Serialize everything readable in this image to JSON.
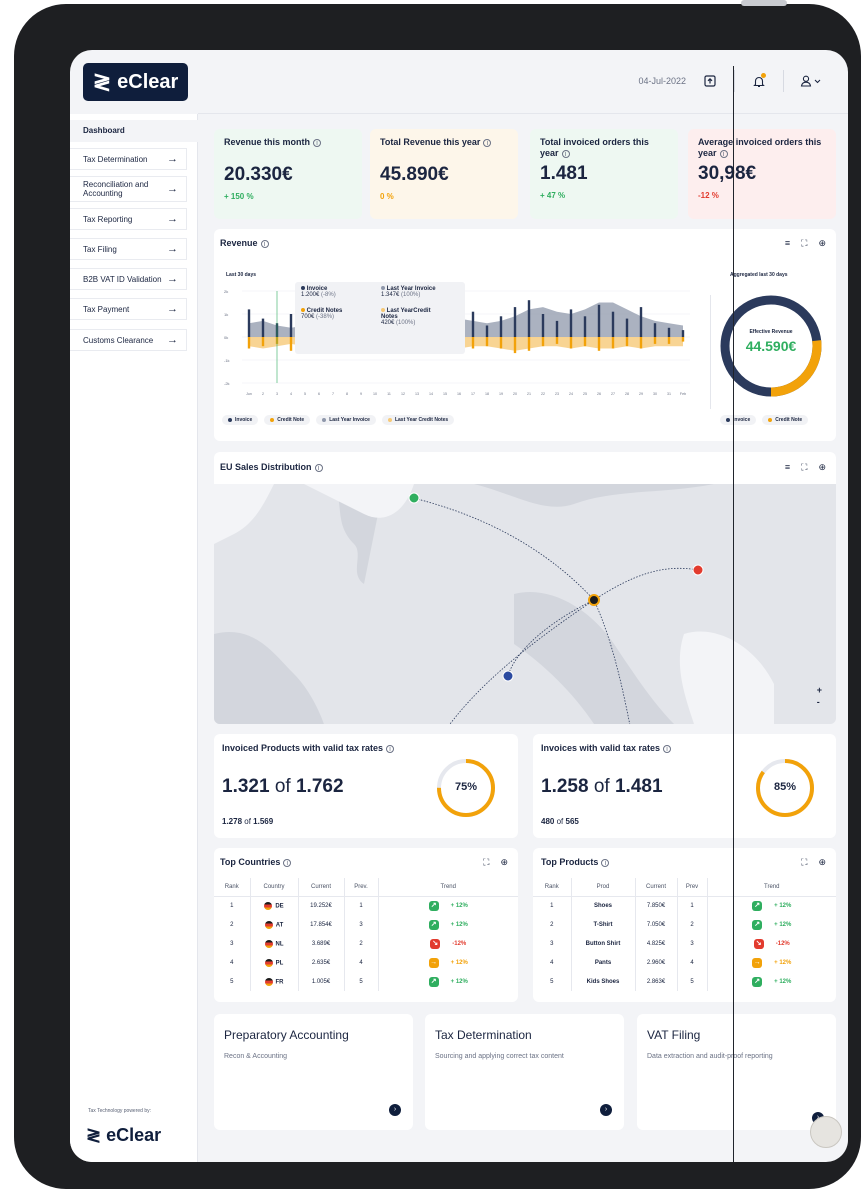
{
  "topbar": {
    "date": "04-Jul-2022"
  },
  "brand": {
    "logo_text": "eClear",
    "logo_mark": "≷",
    "powered_by": "Tax Technology powered by:",
    "bottom_logo_text": "eClear"
  },
  "sidebar": {
    "active": "Dashboard",
    "items": [
      {
        "label": "Tax Determination"
      },
      {
        "label": "Reconciliation and Accounting"
      },
      {
        "label": "Tax Reporting"
      },
      {
        "label": "Tax Filing"
      },
      {
        "label": "B2B VAT ID Validation"
      },
      {
        "label": "Tax Payment"
      },
      {
        "label": "Customs Clearance"
      }
    ]
  },
  "kpis": [
    {
      "title": "Revenue this month",
      "value": "20.330€",
      "change": "+ 150 %",
      "color": "#2fae5f",
      "bg": "#eef8f2"
    },
    {
      "title": "Total Revenue this year",
      "value": "45.890€",
      "change": "0 %",
      "color": "#f2a20a",
      "bg": "#fdf6ea"
    },
    {
      "title": "Total invoiced orders this year",
      "value": "1.481",
      "change": "+ 47 %",
      "color": "#2fae5f",
      "bg": "#eef8f2"
    },
    {
      "title": "Average invoiced orders this year",
      "value": "30,98€",
      "change": "-12 %",
      "color": "#e23b2e",
      "bg": "#fdeeee"
    }
  ],
  "revenue": {
    "title": "Revenue",
    "left_sub": "Last 30 days",
    "right_sub": "Aggregated last 30 days",
    "tooltip": {
      "invoice_label": "Invoice",
      "invoice_value": "1.200€",
      "invoice_pct": "(-8%)",
      "ly_invoice_label": "Last Year Invoice",
      "ly_invoice_value": "1.347€",
      "ly_invoice_pct": "(100%)",
      "credit_label": "Credit Notes",
      "credit_value": "700€",
      "credit_pct": "(-38%)",
      "ly_credit_label": "Last YearCredit Notes",
      "ly_credit_value": "420€",
      "ly_credit_pct": "(100%)"
    },
    "legend": [
      "Invoice",
      "Credit Note",
      "Last Year Invoice",
      "Last Year Credit Notes"
    ],
    "donut_legend": [
      "Invoice",
      "Credit Note"
    ],
    "donut_title": "Effective Revenue",
    "donut_value": "44.590€",
    "donut_invoice_share": 0.73,
    "colors": {
      "invoice": "#2b3a5c",
      "credit": "#f2a20a",
      "ly_invoice": "#8f98ab",
      "ly_credit": "#f6c978",
      "donut_teal": "#2fae5f"
    }
  },
  "chart_data": {
    "type": "bar",
    "y_ticks": [
      "2k",
      "1k",
      "0k",
      "-1k",
      "-2k"
    ],
    "ylim": [
      -2000,
      2000
    ],
    "categories": [
      "Jun",
      "2",
      "3",
      "4",
      "5",
      "6",
      "7",
      "8",
      "9",
      "10",
      "11",
      "12",
      "13",
      "14",
      "15",
      "16",
      "17",
      "18",
      "19",
      "20",
      "21",
      "22",
      "23",
      "24",
      "25",
      "26",
      "27",
      "28",
      "29",
      "30",
      "31",
      "Feb"
    ],
    "series": [
      {
        "name": "Invoice",
        "values": [
          1200,
          800,
          600,
          1000,
          400,
          900,
          1100,
          700,
          500,
          1300,
          900,
          600,
          1200,
          800,
          1400,
          700,
          1100,
          500,
          900,
          1300,
          1600,
          1000,
          700,
          1200,
          900,
          1400,
          1100,
          800,
          1300,
          600,
          400,
          300
        ]
      },
      {
        "name": "Credit Note",
        "values": [
          -500,
          -400,
          -300,
          -600,
          -300,
          -500,
          -700,
          -300,
          -400,
          -600,
          -500,
          -300,
          -500,
          -400,
          -600,
          -300,
          -500,
          -400,
          -500,
          -700,
          -600,
          -400,
          -300,
          -500,
          -400,
          -600,
          -500,
          -400,
          -500,
          -300,
          -300,
          -200
        ]
      },
      {
        "name": "Last Year Invoice",
        "values": [
          600,
          700,
          500,
          400,
          500,
          500,
          600,
          700,
          800,
          900,
          900,
          700,
          600,
          800,
          900,
          800,
          700,
          600,
          700,
          900,
          1200,
          1300,
          1100,
          1000,
          1200,
          1500,
          1500,
          1200,
          900,
          700,
          600,
          500
        ]
      },
      {
        "name": "Last Year Credit Notes",
        "values": [
          -400,
          -500,
          -400,
          -300,
          -400,
          -500,
          -600,
          -500,
          -400,
          -500,
          -600,
          -500,
          -400,
          -500,
          -600,
          -500,
          -400,
          -400,
          -500,
          -600,
          -500,
          -400,
          -400,
          -500,
          -400,
          -500,
          -500,
          -400,
          -500,
          -400,
          -400,
          -400
        ]
      }
    ]
  },
  "map": {
    "title": "EU Sales Distribution",
    "zoom_in": "+",
    "zoom_out": "-"
  },
  "valid_products": {
    "title": "Invoiced Products with valid tax rates",
    "count": "1.321",
    "of": "of",
    "total": "1.762",
    "sub_count": "1.278",
    "sub_total": "1.569",
    "pct": "75%",
    "pct_value": 0.75
  },
  "valid_invoices": {
    "title": "Invoices with valid tax rates",
    "count": "1.258",
    "of": "of",
    "total": "1.481",
    "sub_count": "480",
    "sub_total": "565",
    "pct": "85%",
    "pct_value": 0.85
  },
  "top_countries": {
    "title": "Top Countries",
    "headers": [
      "Rank",
      "Country",
      "Current",
      "Prev.",
      "Trend"
    ],
    "rows": [
      {
        "rank": "1",
        "country": "DE",
        "current": "19.252€",
        "prev": "1",
        "trend": "+ 12%",
        "trend_color": "#2fae5f",
        "arrow": "↗"
      },
      {
        "rank": "2",
        "country": "AT",
        "current": "17.854€",
        "prev": "3",
        "trend": "+ 12%",
        "trend_color": "#2fae5f",
        "arrow": "↗"
      },
      {
        "rank": "3",
        "country": "NL",
        "current": "3.689€",
        "prev": "2",
        "trend": "-12%",
        "trend_color": "#e23b2e",
        "arrow": "↘"
      },
      {
        "rank": "4",
        "country": "PL",
        "current": "2.635€",
        "prev": "4",
        "trend": "+ 12%",
        "trend_color": "#f2a20a",
        "arrow": "→"
      },
      {
        "rank": "5",
        "country": "FR",
        "current": "1.005€",
        "prev": "5",
        "trend": "+ 12%",
        "trend_color": "#2fae5f",
        "arrow": "↗"
      }
    ]
  },
  "top_products": {
    "title": "Top Products",
    "headers": [
      "Rank",
      "Prod",
      "Current",
      "Prev",
      "Trend"
    ],
    "rows": [
      {
        "rank": "1",
        "prod": "Shoes",
        "current": "7.850€",
        "prev": "1",
        "trend": "+ 12%",
        "trend_color": "#2fae5f",
        "arrow": "↗"
      },
      {
        "rank": "2",
        "prod": "T-Shirt",
        "current": "7.050€",
        "prev": "2",
        "trend": "+ 12%",
        "trend_color": "#2fae5f",
        "arrow": "↗"
      },
      {
        "rank": "3",
        "prod": "Button Shirt",
        "current": "4.825€",
        "prev": "3",
        "trend": "-12%",
        "trend_color": "#e23b2e",
        "arrow": "↘"
      },
      {
        "rank": "4",
        "prod": "Pants",
        "current": "2.960€",
        "prev": "4",
        "trend": "+ 12%",
        "trend_color": "#f2a20a",
        "arrow": "→"
      },
      {
        "rank": "5",
        "prod": "Kids Shoes",
        "current": "2.863€",
        "prev": "5",
        "trend": "+ 12%",
        "trend_color": "#2fae5f",
        "arrow": "↗"
      }
    ]
  },
  "bottom_cards": [
    {
      "title": "Preparatory Accounting",
      "sub": "Recon & Accounting"
    },
    {
      "title": "Tax Determination",
      "sub": "Sourcing and applying correct tax content"
    },
    {
      "title": "VAT Filing",
      "sub": "Data extraction and audit-proof reporting"
    }
  ]
}
